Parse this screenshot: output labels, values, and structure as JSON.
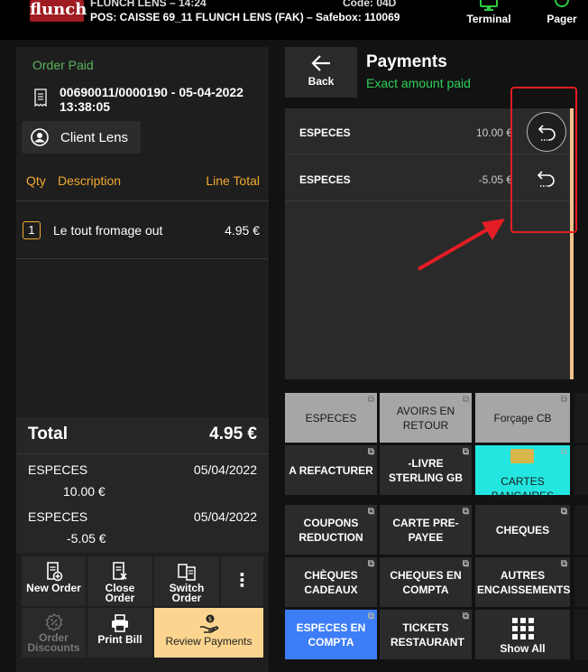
{
  "header": {
    "logo": "flunch",
    "store": "FLUNCH LENS – 14:24",
    "pos": "POS: CAISSE 69_11 FLUNCH LENS (FAK) – Safebox: 110069",
    "code": "Code: 04D",
    "terminal": "Terminal",
    "pager": "Pager"
  },
  "order": {
    "status": "Order Paid",
    "id": "00690011/0000190 - 05-04-2022 13:38:05",
    "client": "Client Lens",
    "columns": {
      "qty": "Qty",
      "description": "Description",
      "line_total": "Line Total"
    },
    "lines": [
      {
        "qty": "1",
        "description": "Le tout fromage out",
        "total": "4.95 €"
      }
    ],
    "total_label": "Total",
    "total_value": "4.95 €",
    "payments": [
      {
        "method": "ESPECES",
        "date": "05/04/2022",
        "amount": "10.00 €"
      },
      {
        "method": "ESPECES",
        "date": "05/04/2022",
        "amount": "-5.05 €"
      }
    ]
  },
  "actions": {
    "new_order": "New Order",
    "close_order_1": "Close",
    "close_order_2": "Order",
    "switch_order_1": "Switch",
    "switch_order_2": "Order",
    "more": "⋮",
    "order_discounts_1": "Order",
    "order_discounts_2": "Discounts",
    "print_bill": "Print Bill",
    "review_payments": "Review Payments"
  },
  "payments_panel": {
    "back": "Back",
    "title": "Payments",
    "subtitle": "Exact amount paid",
    "rows": [
      {
        "method": "ESPECES",
        "amount": "10.00 €"
      },
      {
        "method": "ESPECES",
        "amount": "-5.05 €"
      }
    ]
  },
  "methods": [
    {
      "label": "ESPECES",
      "style": "light"
    },
    {
      "label": "AVOIRS EN RETOUR",
      "style": "light"
    },
    {
      "label": "Forçage CB",
      "style": "light"
    },
    {
      "label": "A REFACTURER",
      "style": "dark"
    },
    {
      "label": "-LIVRE STERLING GB",
      "style": "dark"
    },
    {
      "label": "CARTES BANCAIRES",
      "style": "cyan"
    },
    {
      "label": "COUPONS REDUCTION",
      "style": "dark"
    },
    {
      "label": "CARTE PRE-PAYEE",
      "style": "dark"
    },
    {
      "label": "CHEQUES",
      "style": "dark"
    },
    {
      "label": "CHÈQUES CADEAUX",
      "style": "dark"
    },
    {
      "label": "CHEQUES EN COMPTA",
      "style": "dark"
    },
    {
      "label": "AUTRES ENCAISSEMENTS",
      "style": "dark"
    },
    {
      "label": "ESPECES EN COMPTA",
      "style": "blue"
    },
    {
      "label": "TICKETS RESTAURANT",
      "style": "dark"
    },
    {
      "label": "Show All",
      "style": "showall"
    }
  ],
  "colors": {
    "accent_orange": "#f2a933",
    "paid_green": "#57b45a",
    "exact_green": "#2ed158",
    "review_bg": "#fbd58f",
    "cyan": "#23e6e0",
    "blue": "#3d7ef6",
    "annotation_red": "#e31e24"
  }
}
